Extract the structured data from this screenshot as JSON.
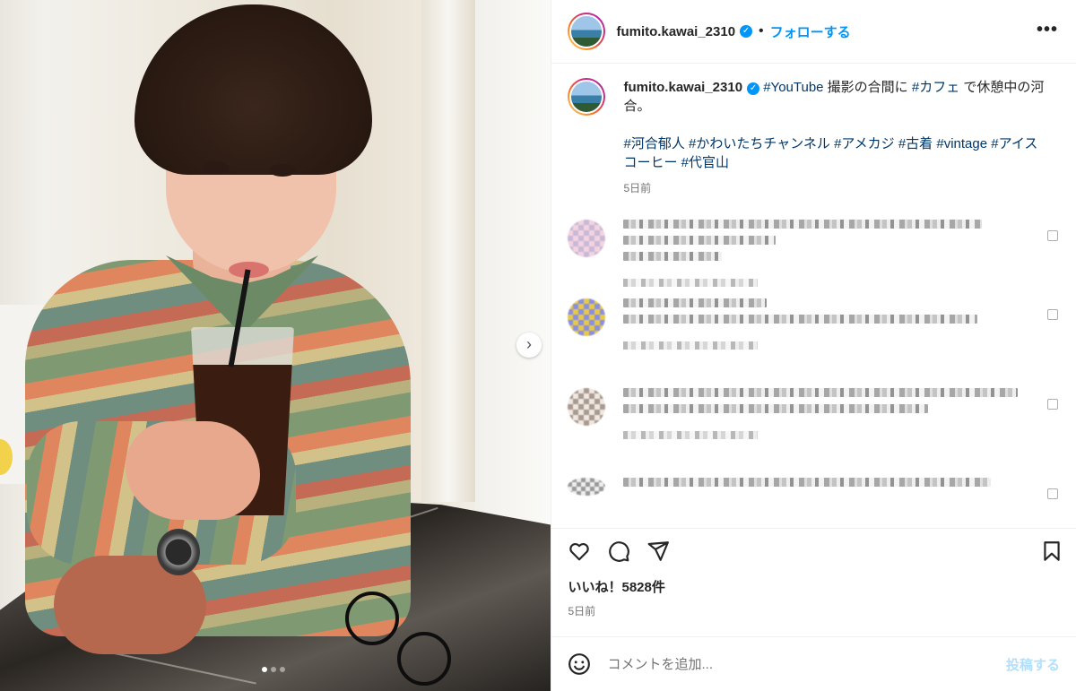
{
  "header": {
    "username": "fumito.kawai_2310",
    "separator": "•",
    "follow_label": "フォローする",
    "more_label": "•••"
  },
  "caption": {
    "username": "fumito.kawai_2310",
    "line1_parts": [
      "#YouTube",
      " 撮影の合間に ",
      "#カフェ",
      " で休憩中の河合。"
    ],
    "tags_line": [
      "#河合郁人",
      "#かわいたちチャンネル",
      "#アメカジ",
      "#古着",
      "#vintage",
      "#アイスコーヒー",
      "#代官山"
    ],
    "time": "5日前"
  },
  "comments_count_visible": 4,
  "likes": "いいね！5828件",
  "date": "5日前",
  "comment_box": {
    "placeholder": "コメントを追加...",
    "post_label": "投稿する"
  },
  "carousel": {
    "next_label": "›",
    "total": 3,
    "current": 1
  },
  "colors": {
    "accent": "#0095f6",
    "hashtag": "#00376b",
    "muted": "#737373",
    "post_disabled": "#b2dffc"
  },
  "icons": [
    "verified-badge-icon",
    "more-options-icon",
    "heart-icon",
    "comment-icon",
    "share-icon",
    "bookmark-icon",
    "emoji-icon",
    "chevron-right-icon"
  ]
}
